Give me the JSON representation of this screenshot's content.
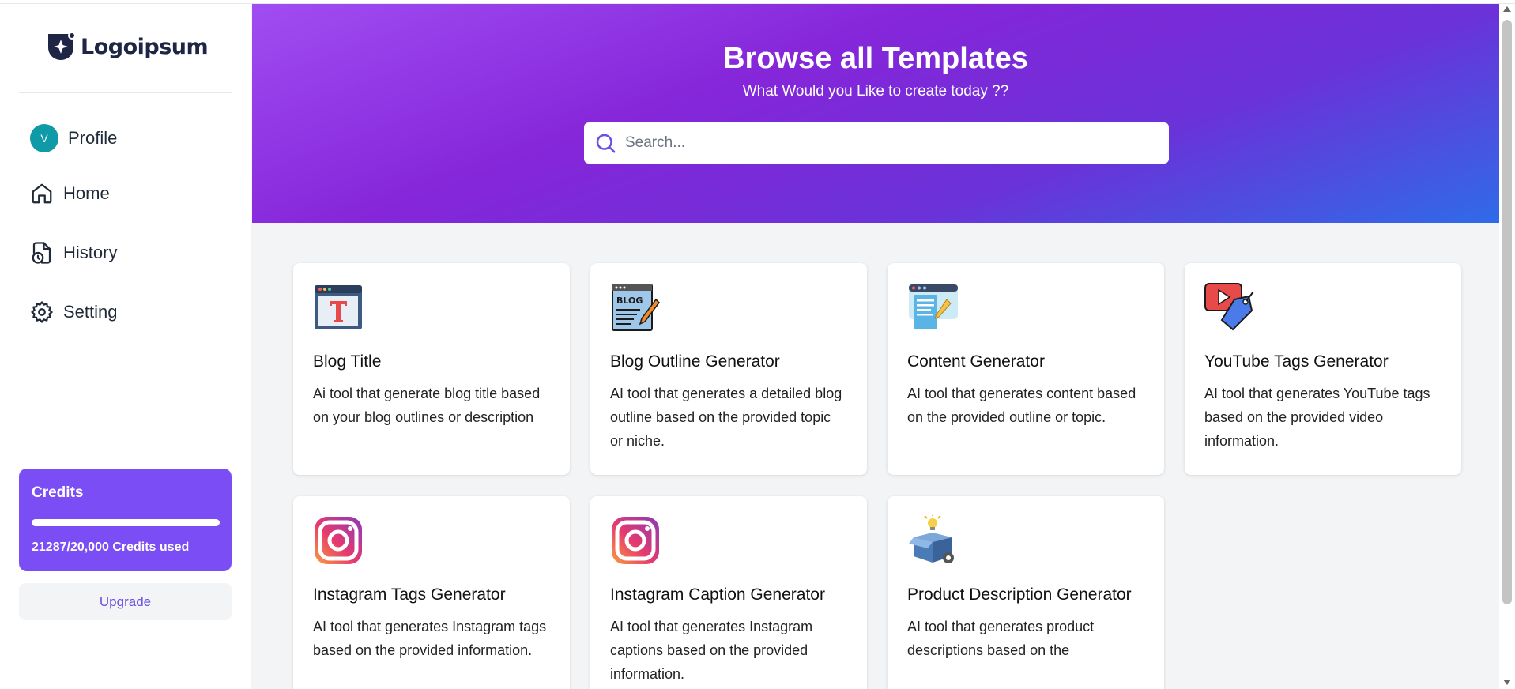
{
  "brand": {
    "name": "Logoipsum",
    "color": "#1f2544"
  },
  "sidebar": {
    "items": [
      {
        "label": "Profile",
        "avatar_initial": "V",
        "icon": "avatar"
      },
      {
        "label": "Home",
        "icon": "home-icon"
      },
      {
        "label": "History",
        "icon": "history-icon"
      },
      {
        "label": "Setting",
        "icon": "gear-icon"
      }
    ],
    "credits": {
      "title": "Credits",
      "usage_text": "21287/20,000 Credits used",
      "progress_fraction": 1.0,
      "color": "#7b4ef5"
    },
    "upgrade_label": "Upgrade"
  },
  "banner": {
    "title": "Browse all Templates",
    "subtitle": "What Would you Like to create today ??",
    "search_placeholder": "Search..."
  },
  "templates": [
    {
      "title": "Blog Title",
      "description": "Ai tool that generate blog title based on your blog outlines or description",
      "icon": "blog-title-icon"
    },
    {
      "title": "Blog Outline Generator",
      "description": "AI tool that generates a detailed blog outline based on the provided topic or niche.",
      "icon": "blog-icon"
    },
    {
      "title": "Content Generator",
      "description": "AI tool that generates content based on the provided outline or topic.",
      "icon": "content-icon"
    },
    {
      "title": "YouTube Tags Generator",
      "description": "AI tool that generates YouTube tags based on the provided video information.",
      "icon": "youtube-tag-icon"
    },
    {
      "title": "Instagram Tags Generator",
      "description": "AI tool that generates Instagram tags based on the provided information.",
      "icon": "instagram-icon"
    },
    {
      "title": "Instagram Caption Generator",
      "description": "AI tool that generates Instagram captions based on the provided information.",
      "icon": "instagram-icon"
    },
    {
      "title": "Product Description Generator",
      "description": "AI tool that generates product descriptions based on the",
      "icon": "product-box-icon"
    }
  ]
}
